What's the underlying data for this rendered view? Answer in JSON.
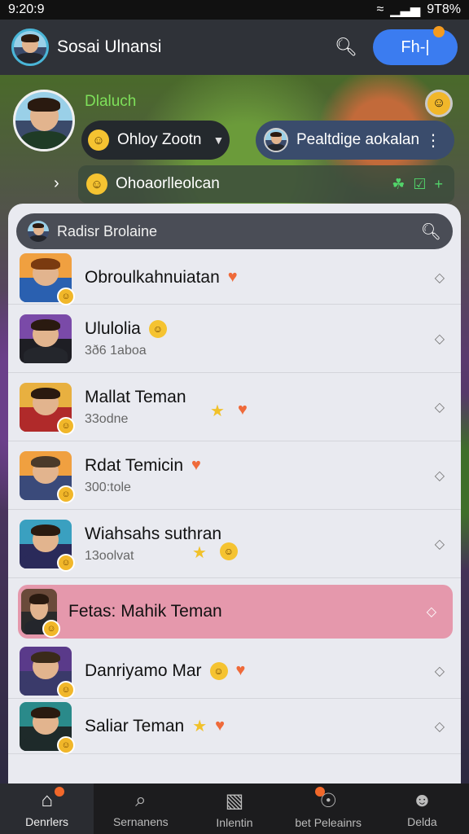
{
  "status_bar": {
    "time": "9:20:9",
    "battery": "9T8%"
  },
  "header": {
    "title": "Sosai Ulnansi",
    "action_button": "Fh-|"
  },
  "profile": {
    "name": "Dlaluch",
    "status_chip": "Ohloy Zootn",
    "friend_chip": "Pealtdige aokalan",
    "mood_text": "Ohoaorlleolcan"
  },
  "search": {
    "placeholder": "Radisr Brolaine"
  },
  "friends": [
    {
      "name": "Obroulkahnuiatan",
      "sub": ""
    },
    {
      "name": "Ululolia",
      "sub": "3ð6 1aboa"
    },
    {
      "name": "Mallat Teman",
      "sub": "33odne"
    },
    {
      "name": "Rdat Temicin",
      "sub": "300:tole"
    },
    {
      "name": "Wiahsahs suthran",
      "sub": "13oolvat"
    },
    {
      "name": "Fetas: Mahik Teman",
      "sub": ""
    },
    {
      "name": "Danriyamo Mar",
      "sub": ""
    },
    {
      "name": "Saliar Teman",
      "sub": ""
    }
  ],
  "nav": [
    {
      "label": "Denrlers",
      "icon": "home-icon"
    },
    {
      "label": "Sernanens",
      "icon": "search-icon"
    },
    {
      "label": "Inlentin",
      "icon": "map-icon"
    },
    {
      "label": "bet Peleainrs",
      "icon": "compass-icon"
    },
    {
      "label": "Delda",
      "icon": "profile-icon"
    }
  ],
  "colors": {
    "accent": "#3b7cf0",
    "highlight": "#e598ac",
    "name_green": "#7ee05a"
  }
}
